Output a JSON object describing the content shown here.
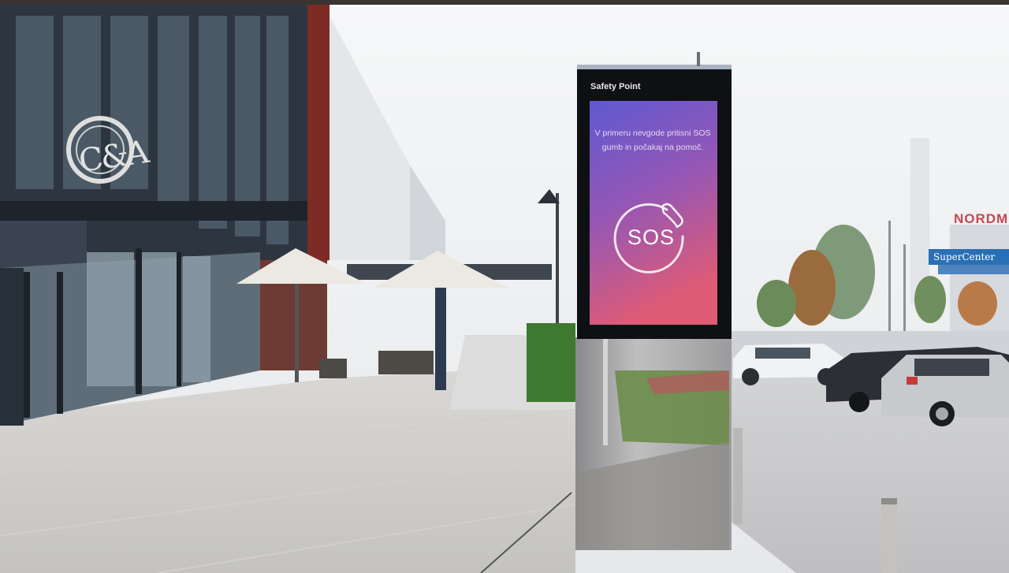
{
  "scene": {
    "description_type": "photo",
    "kiosk": {
      "brand_label": "Safety Point",
      "screen_message": "V primeru nevgode pritisni SOS gumb in počakaj na pomoč.",
      "sos_label": "SOS",
      "phone_icon": "phone-handset-icon"
    },
    "storefront_logo": "C&A",
    "road_sign": "SuperCenter",
    "distant_store_sign": "NORDM"
  },
  "colors": {
    "sky": "#f3f4f6",
    "pavement": "#c9c9c9",
    "kiosk_frame": "#0e0f12",
    "screen_top": "#6a56c9",
    "screen_bottom": "#d35a7c",
    "facade_dark": "#1c232b",
    "facade_red": "#7b2a24",
    "hedge": "#3c7a2e"
  }
}
